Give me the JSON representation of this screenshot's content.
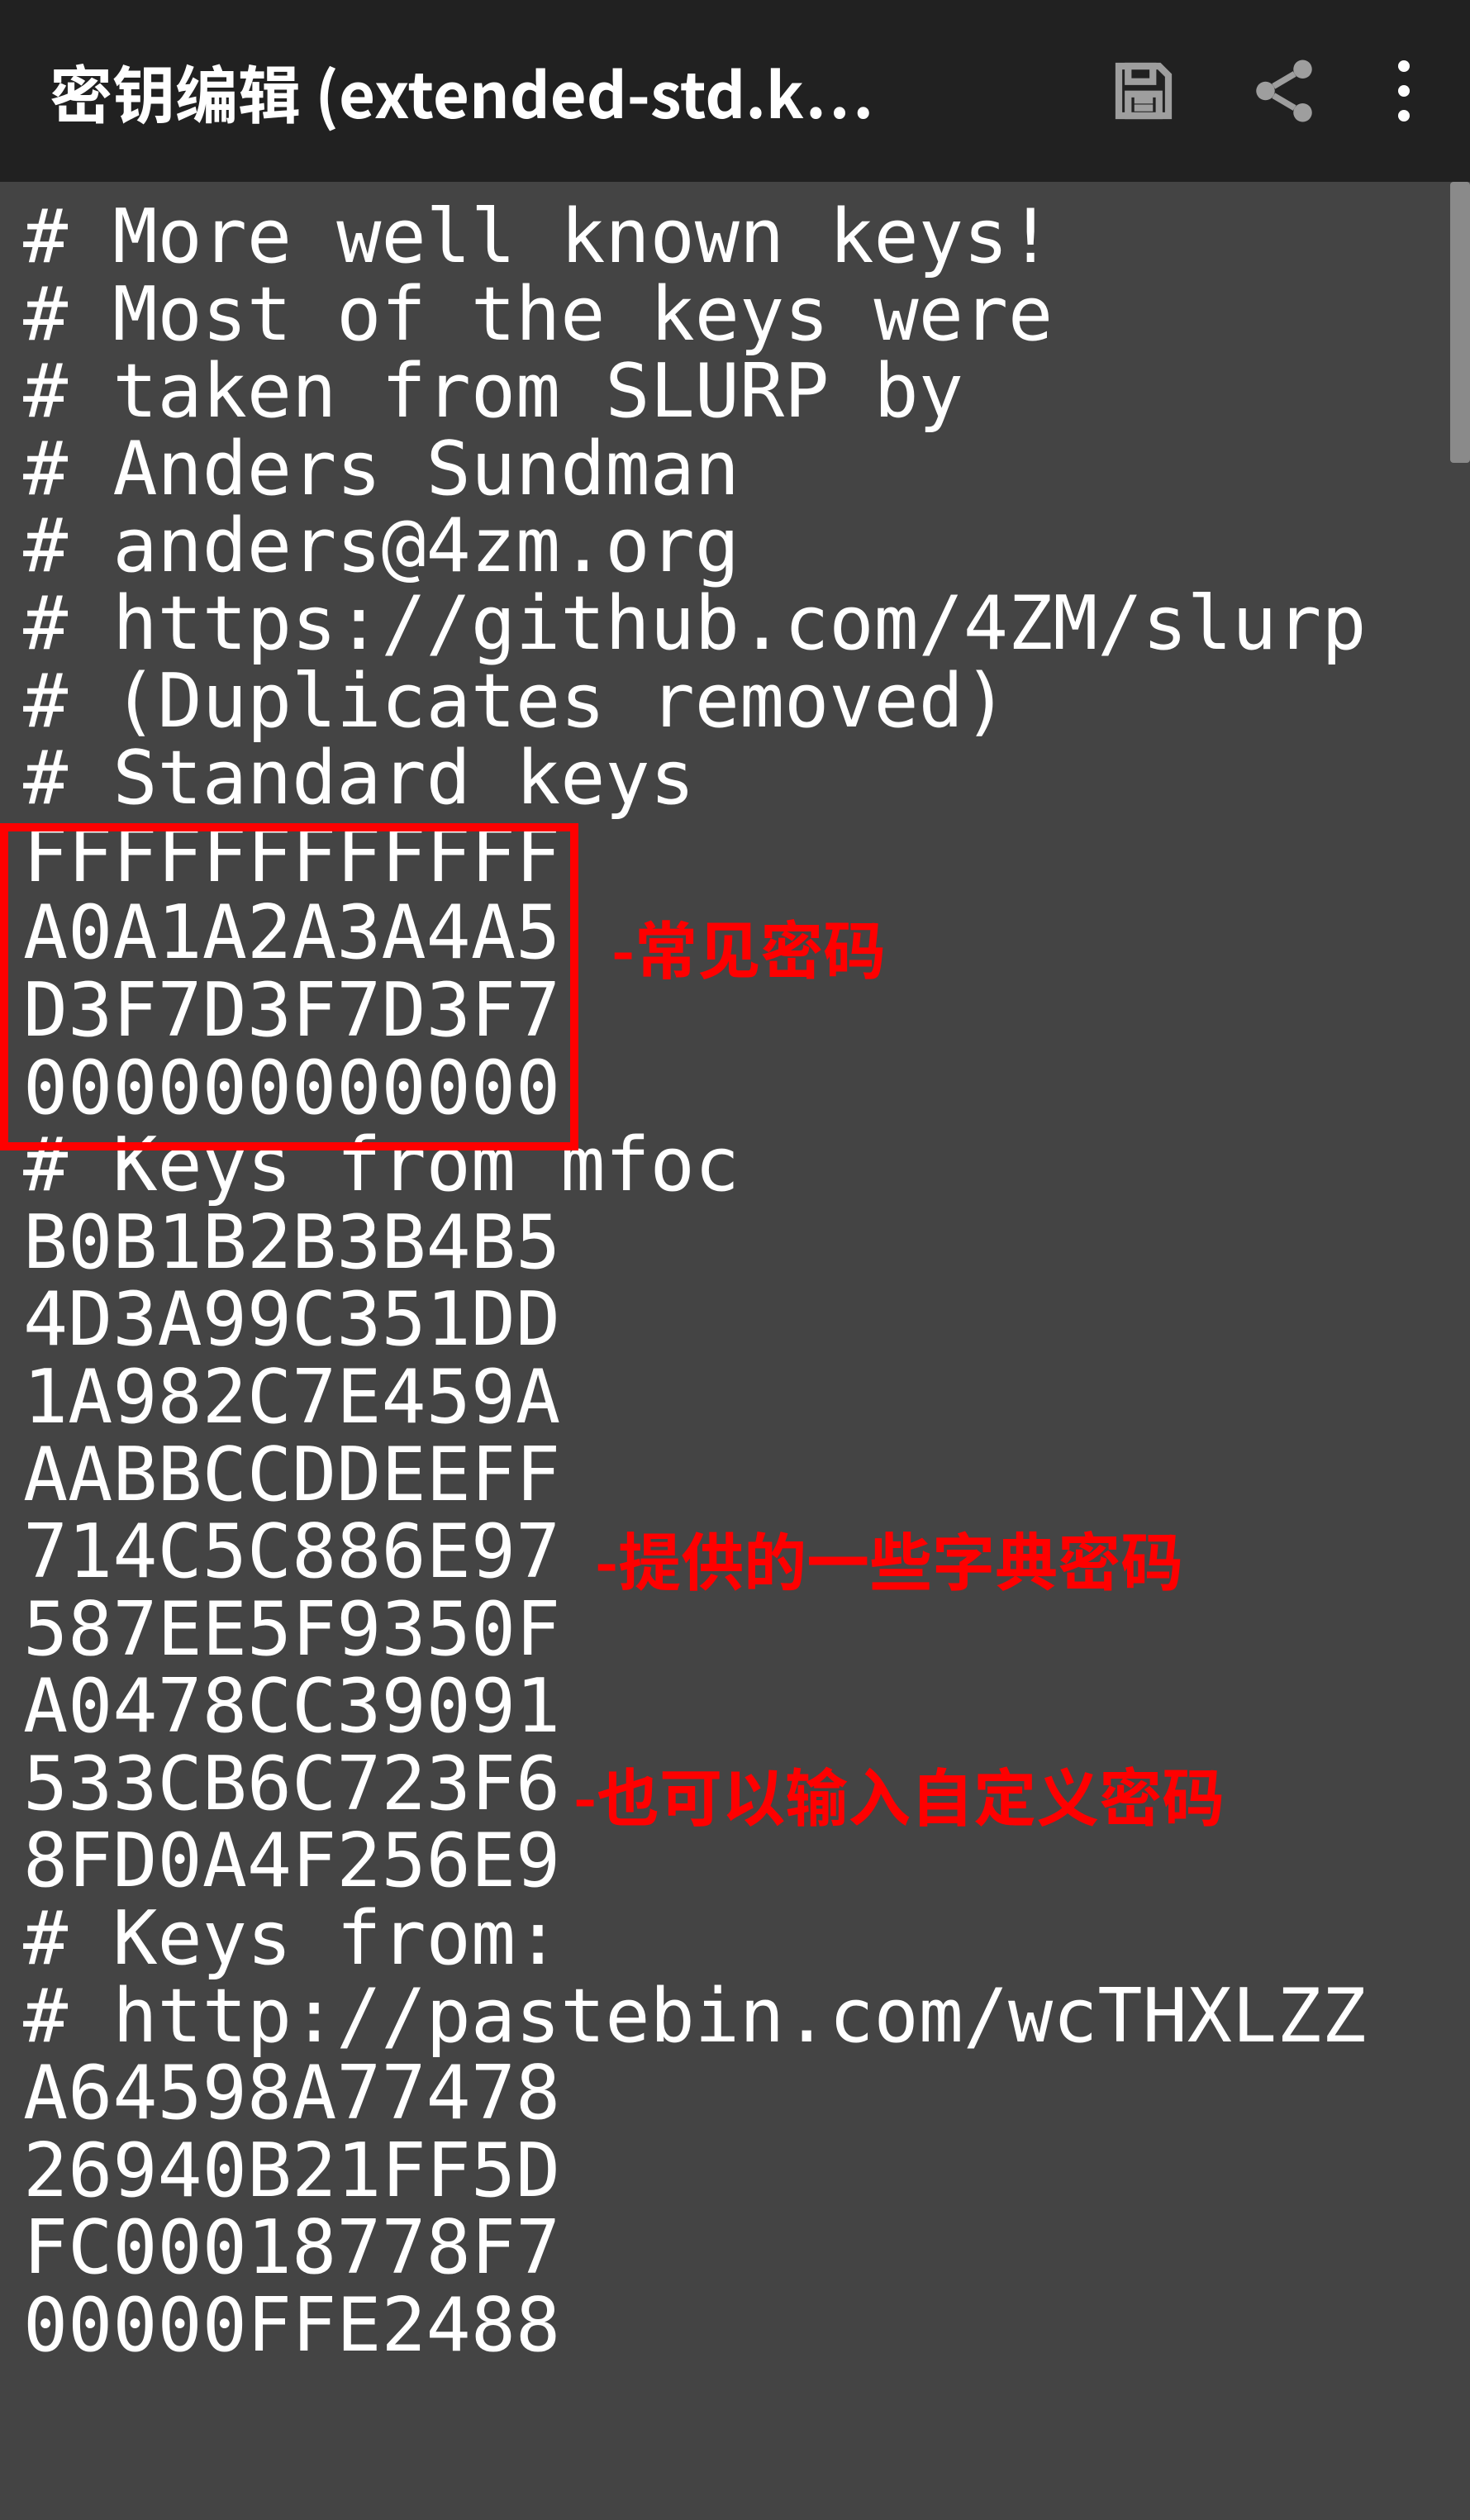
{
  "topbar": {
    "title": "密钥编辑 (extended-std.k…",
    "save_label": "save-icon",
    "share_label": "share-icon",
    "overflow_label": "overflow-menu-icon"
  },
  "editor": {
    "lines": [
      "# More well known keys!",
      "# Most of the keys were",
      "# taken from SLURP by",
      "# Anders Sundman",
      "# anders@4zm.org",
      "# https://github.com/4ZM/slurp",
      "# (Duplicates removed)",
      "# Standard keys",
      "FFFFFFFFFFFF",
      "A0A1A2A3A4A5",
      "D3F7D3F7D3F7",
      "000000000000",
      "# Keys from mfoc",
      "B0B1B2B3B4B5",
      "4D3A99C351DD",
      "1A982C7E459A",
      "AABBCCDDEEFF",
      "714C5C886E97",
      "587EE5F9350F",
      "A0478CC39091",
      "533CB6C723F6",
      "8FD0A4F256E9",
      "# Keys from:",
      "# http://pastebin.com/wcTHXLZZ",
      "A64598A77478",
      "26940B21FF5D",
      "FC00018778F7",
      "00000FFE2488"
    ]
  },
  "annotations": {
    "a1": "-常见密码",
    "a2": "-提供的一些字典密码",
    "a3": "-也可以输入自定义密码"
  }
}
